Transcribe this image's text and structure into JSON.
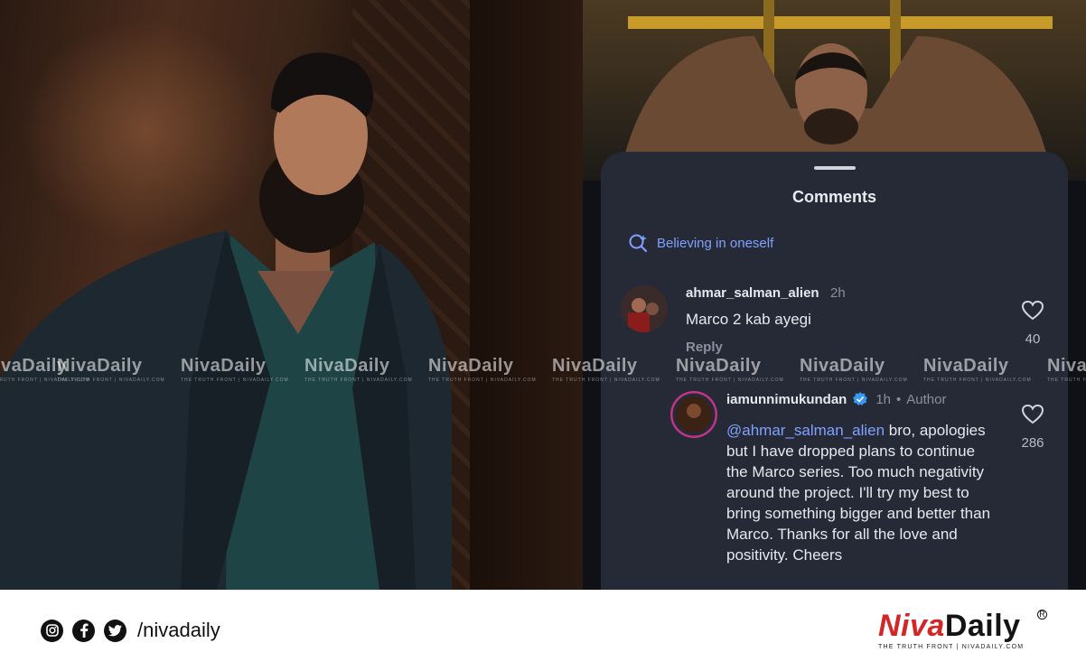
{
  "comments_sheet": {
    "title": "Comments",
    "search_chip": "Believing in oneself",
    "comments": [
      {
        "username": "ahmar_salman_alien",
        "time": "2h",
        "text": "Marco 2 kab ayegi",
        "reply_label": "Reply",
        "likes": "40"
      },
      {
        "username": "iamunnimukundan",
        "verified": true,
        "time": "1h",
        "author_tag": "Author",
        "mention": "@ahmar_salman_alien",
        "text": " bro, apologies but I have dropped plans to continue the Marco series. Too much negativity around the project. I'll try my best to bring something bigger and better than Marco. Thanks for all the love and positivity. Cheers",
        "likes": "286"
      }
    ]
  },
  "watermark": {
    "brand": "NivaDaily",
    "tagline": "THE TRUTH FRONT | NIVADAILY.COM"
  },
  "footer": {
    "social_icons": [
      "instagram-icon",
      "facebook-icon",
      "twitter-icon"
    ],
    "handle": "/nivadaily",
    "logo_niva": "Niva",
    "logo_daily": "Daily",
    "logo_tagline": "THE TRUTH FRONT | NIVADAILY.COM",
    "logo_registered": "R"
  },
  "colors": {
    "brand_red": "#d32727",
    "sheet_bg": "#262a36",
    "link_blue": "#7fa1ff"
  }
}
